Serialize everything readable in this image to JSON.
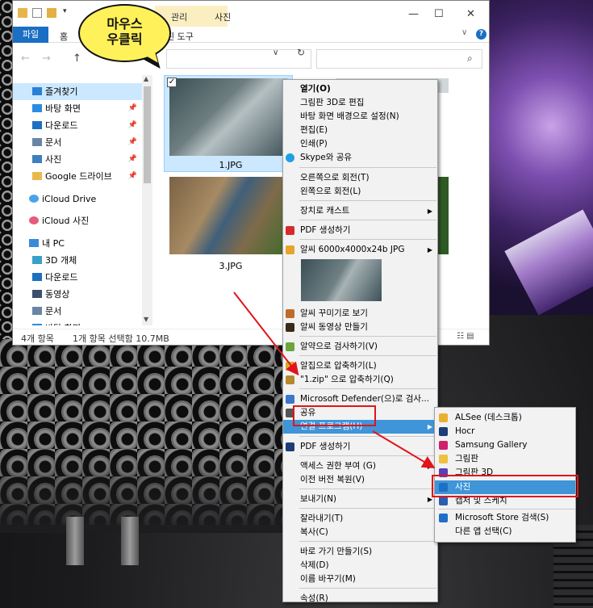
{
  "callout": {
    "line1": "마우스",
    "line2": "우클릭"
  },
  "window": {
    "title": "사진",
    "context_tab_group": "관리",
    "tabs": {
      "file": "파일",
      "home": "홈",
      "picture_tools": "진 도구"
    },
    "quick_access_glyph": "▾"
  },
  "nav": [
    {
      "label": "즐겨찾기",
      "icon": "star-icon",
      "selected": true
    },
    {
      "label": "바탕 화면",
      "icon": "desktop-icon",
      "pinned": true
    },
    {
      "label": "다운로드",
      "icon": "download-icon",
      "pinned": true
    },
    {
      "label": "문서",
      "icon": "document-icon",
      "pinned": true
    },
    {
      "label": "사진",
      "icon": "pictures-icon",
      "pinned": true
    },
    {
      "label": "Google 드라이브",
      "icon": "folder-icon",
      "pinned": true
    },
    {
      "label": "iCloud Drive",
      "icon": "icloud-icon"
    },
    {
      "label": "iCloud 사진",
      "icon": "icloud-photos-icon"
    },
    {
      "label": "내 PC",
      "icon": "pc-icon"
    },
    {
      "label": "3D 개체",
      "icon": "3d-objects-icon"
    },
    {
      "label": "다운로드",
      "icon": "download-icon"
    },
    {
      "label": "동영상",
      "icon": "video-icon"
    },
    {
      "label": "문서",
      "icon": "document-icon"
    },
    {
      "label": "바탕 화면",
      "icon": "desktop-icon"
    }
  ],
  "files": [
    {
      "name": "1.JPG",
      "selected": true
    },
    {
      "name": "3.JPG"
    }
  ],
  "status": {
    "count": "4개 항목",
    "selection": "1개 항목 선택함 10.7MB"
  },
  "menu": {
    "open": "열기(O)",
    "paint3d_edit": "그림판 3D로 편집",
    "set_wallpaper": "바탕 화면 배경으로 설정(N)",
    "edit": "편집(E)",
    "print": "인쇄(P)",
    "skype_share": "Skype와 공유",
    "rotate_right": "오른쪽으로 회전(T)",
    "rotate_left": "왼쪽으로 회전(L)",
    "cast": "장치로 캐스트",
    "pdf_create": "PDF 생성하기",
    "alsee_info": "알씨 6000x4000x24b JPG",
    "alsee_decorate": "알씨 꾸미기로 보기",
    "alsee_video": "알씨 동영상 만들기",
    "alyac_scan": "알약으로 검사하기(V)",
    "alzip_compress": "알집으로 압축하기(L)",
    "alzip_named": "\"1.zip\" 으로 압축하기(Q)",
    "defender": "Microsoft Defender(으)로 검사...",
    "share": "공유",
    "open_with": "연결 프로그램(H)",
    "pdf_create2": "PDF 생성하기",
    "grant_access": "액세스 권한 부여 (G)",
    "restore_prev": "이전 버전 복원(V)",
    "send_to": "보내기(N)",
    "cut": "잘라내기(T)",
    "copy": "복사(C)",
    "create_shortcut": "바로 가기 만들기(S)",
    "delete": "삭제(D)",
    "rename": "이름 바꾸기(M)",
    "properties": "속성(R)"
  },
  "submenu": [
    {
      "label": "ALSee (데스크톱)",
      "icon": "alsee-icon",
      "color": "#e9b030"
    },
    {
      "label": "Hocr",
      "icon": "hocr-icon",
      "color": "#1d3c7a"
    },
    {
      "label": "Samsung Gallery",
      "icon": "samsung-gallery-icon",
      "color": "#d0206c"
    },
    {
      "label": "그림판",
      "icon": "paint-icon",
      "color": "#f0c040"
    },
    {
      "label": "그림판 3D",
      "icon": "paint3d-icon",
      "color": "#5b3fb8"
    },
    {
      "label": "사진",
      "icon": "photos-icon",
      "color": "#1f6fc6",
      "highlighted": true
    },
    {
      "label": "캡처 및 스케치",
      "icon": "snip-sketch-icon",
      "color": "#2a5fb0"
    },
    {
      "label": "Microsoft Store 검색(S)",
      "icon": "store-icon",
      "color": "#1f6fc6"
    },
    {
      "label": "다른 앱 선택(C)",
      "icon": "blank-icon"
    }
  ],
  "colors": {
    "accent": "#1a6fc4",
    "highlight": "#3f95d8",
    "annotation_red": "#e0151b",
    "callout_yellow": "#fff15a"
  }
}
